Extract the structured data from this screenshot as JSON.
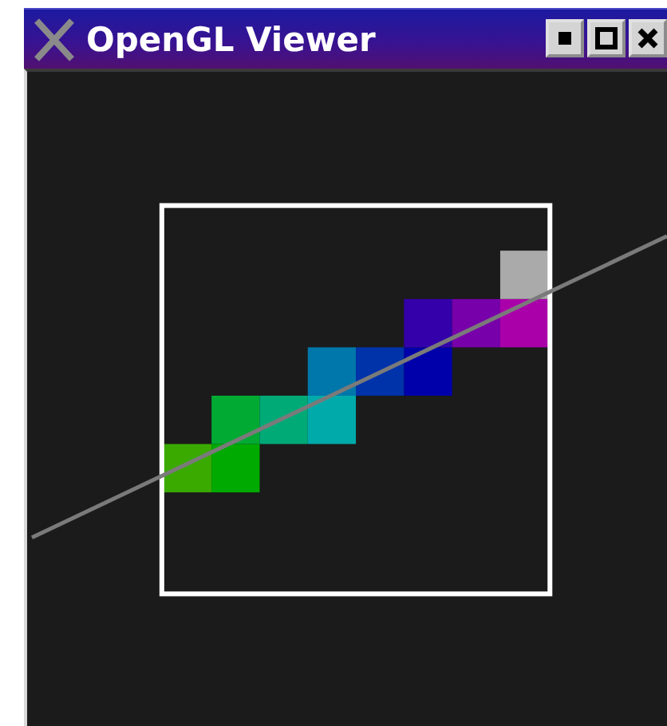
{
  "window": {
    "title": "OpenGL Viewer"
  }
}
